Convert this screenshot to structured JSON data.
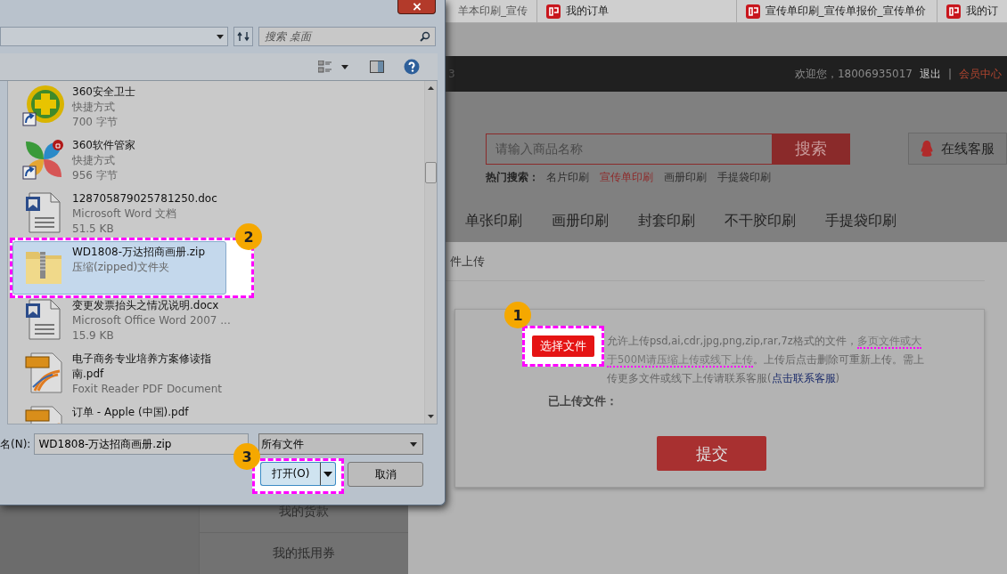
{
  "browser_tabs": [
    {
      "title": "羊本印刷_宣传",
      "icon": false
    },
    {
      "title": "我的订单",
      "icon": true
    },
    {
      "title": "宣传单印刷_宣传单报价_宣传单价",
      "icon": true
    },
    {
      "title": "我的订",
      "icon": true
    }
  ],
  "site_header": {
    "fragment": "3",
    "greeting": "欢迎您，18006935017",
    "logout": "退出",
    "separator": "|",
    "member_center": "会员中心"
  },
  "search": {
    "placeholder": "请输入商品名称",
    "button": "搜索",
    "hot_label": "热门搜索：",
    "hot_terms": [
      {
        "text": "名片印刷",
        "selected": false
      },
      {
        "text": "宣传单印刷",
        "selected": true
      },
      {
        "text": "画册印刷",
        "selected": false
      },
      {
        "text": "手提袋印刷",
        "selected": false
      }
    ]
  },
  "service_button": "在线客服",
  "nav": [
    "单张印刷",
    "画册印刷",
    "封套印刷",
    "不干胶印刷",
    "手提袋印刷"
  ],
  "sidebar_menu": [
    "我的货款",
    "我的抵用券"
  ],
  "upload_panel": {
    "title": "件上传",
    "choose_button": "选择文件",
    "callout": "1",
    "notice": [
      {
        "kind": "plain",
        "text": "允许上传psd,ai,cdr,jpg,png,zip,rar,7z格式的文件，"
      },
      {
        "kind": "highlight",
        "text": "多页文件或大于500M请压缩上传或线下上传"
      },
      {
        "kind": "plain",
        "text": "。上传后点击删除可重新上传。需上传更多文件或线下上传请联系客服("
      },
      {
        "kind": "link",
        "text": "点击联系客服"
      },
      {
        "kind": "plain",
        "text": ")"
      }
    ],
    "uploaded_label": "已上传文件：",
    "submit": "提交"
  },
  "dialog": {
    "search_placeholder": "搜索 桌面",
    "files": [
      {
        "kind": "green_plus",
        "name": "360安全卫士",
        "type": "快捷方式",
        "size": "700 字节",
        "shortcut": true,
        "selected": false
      },
      {
        "kind": "petals",
        "name": "360软件管家",
        "type": "快捷方式",
        "size": "956 字节",
        "shortcut": true,
        "selected": false
      },
      {
        "kind": "word",
        "name": "128705879025781250.doc",
        "type": "Microsoft Word 文档",
        "size": "51.5 KB",
        "selected": false
      },
      {
        "kind": "zip",
        "name": "WD1808-万达招商画册.zip",
        "type": "压缩(zipped)文件夹",
        "selected": true,
        "callout": "2"
      },
      {
        "kind": "word",
        "name": "变更发票抬头之情况说明.docx",
        "type": "Microsoft Office Word 2007 ...",
        "size": "15.9 KB",
        "selected": false
      },
      {
        "kind": "pdf",
        "name": "电子商务专业培养方案修读指南.pdf",
        "type": "Foxit Reader PDF Document",
        "selected": false
      },
      {
        "kind": "pdf",
        "name": "订单 - Apple (中国).pdf",
        "selected": false
      }
    ],
    "filename_label": "名(N):",
    "filename_value": "WD1808-万达招商画册.zip",
    "file_type": "所有文件",
    "open_button": "打开(O)",
    "open_callout": "3",
    "cancel_button": "取消"
  }
}
